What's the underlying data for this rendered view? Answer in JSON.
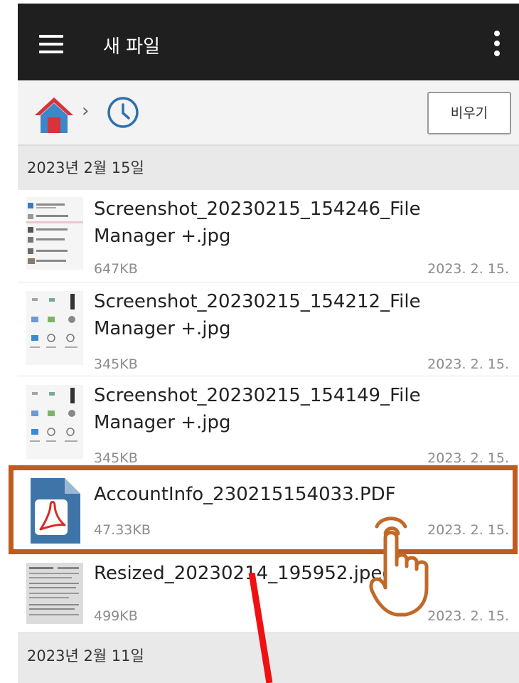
{
  "appbar": {
    "title": "새 파일",
    "menu_icon": "hamburger-menu-icon",
    "more_icon": "more-vertical-icon"
  },
  "breadcrumb": {
    "home_icon": "home-icon",
    "separator": "›",
    "recent_icon": "clock-icon",
    "clear_label": "비우기"
  },
  "sections": [
    {
      "date": "2023년 2월 15일",
      "files": [
        {
          "name": "Screenshot_20230215_154246_File Manager +.jpg",
          "size": "647KB",
          "date": "2023. 2. 15."
        },
        {
          "name": "Screenshot_20230215_154212_File Manager +.jpg",
          "size": "345KB",
          "date": "2023. 2. 15."
        },
        {
          "name": "Screenshot_20230215_154149_File Manager +.jpg",
          "size": "345KB",
          "date": "2023. 2. 15."
        },
        {
          "name": "AccountInfo_230215154033.PDF",
          "size": "47.33KB",
          "date": "2023. 2. 15."
        },
        {
          "name": "Resized_20230214_195952.jpeg",
          "size": "499KB",
          "date": "2023. 2. 15."
        }
      ]
    },
    {
      "date": "2023년 2월 11일",
      "files": []
    }
  ],
  "annotations": {
    "highlight_color": "#bf5b1e",
    "arrow_color": "#ee1111",
    "pointer_icon": "tap-hand-icon"
  },
  "colors": {
    "appbar_bg": "#1f1f1f",
    "header_bg": "#e9e9e9",
    "pdf_blue": "#3f74a8",
    "pdf_red": "#d62e27"
  }
}
